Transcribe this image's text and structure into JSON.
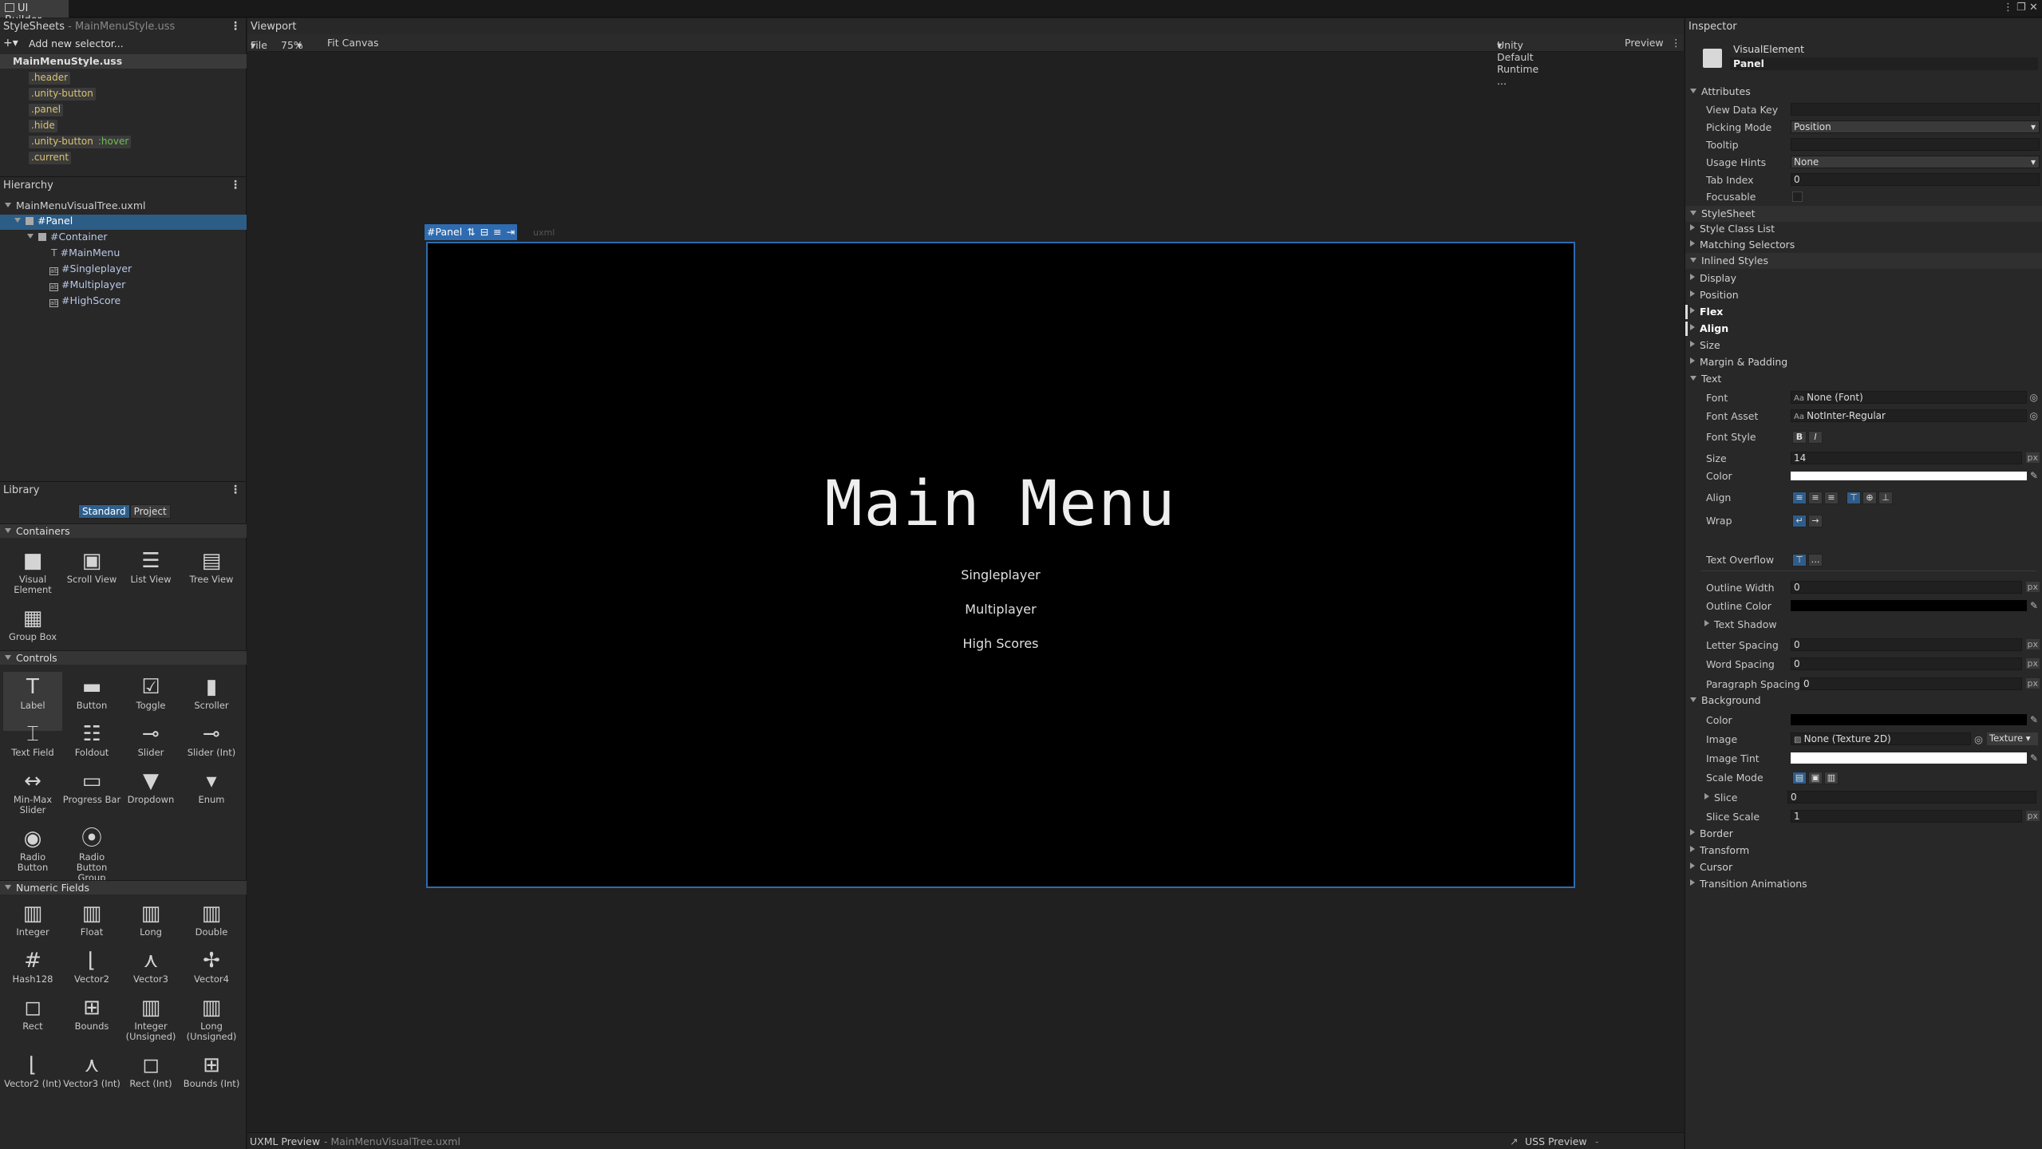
{
  "window": {
    "title": "UI Builder"
  },
  "stylesheets": {
    "header": "StyleSheets",
    "header_file": "- MainMenuStyle.uss",
    "add_placeholder": "Add new selector...",
    "file": "MainMenuStyle.uss",
    "selectors": [
      ".header",
      ".unity-button",
      ".panel",
      ".hide",
      ".unity-button",
      ".current"
    ],
    "hover_pseudo": ":hover"
  },
  "hierarchy": {
    "header": "Hierarchy",
    "file": "MainMenuVisualTree.uxml",
    "items": [
      "#Panel",
      "#Container",
      "#MainMenu",
      "#Singleplayer",
      "#Multiplayer",
      "#HighScore"
    ]
  },
  "library": {
    "header": "Library",
    "tabs": [
      "Standard",
      "Project"
    ],
    "sections": [
      "Containers",
      "Controls",
      "Numeric Fields"
    ],
    "containers": [
      "Visual Element",
      "Scroll View",
      "List View",
      "Tree View",
      "Group Box"
    ],
    "controls": [
      "Label",
      "Button",
      "Toggle",
      "Scroller",
      "Text Field",
      "Foldout",
      "Slider",
      "Slider (Int)",
      "Min-Max Slider",
      "Progress Bar",
      "Dropdown",
      "Enum",
      "Radio Button",
      "Radio Button Group"
    ],
    "numeric": [
      "Integer",
      "Float",
      "Long",
      "Double",
      "Hash128",
      "Vector2",
      "Vector3",
      "Vector4",
      "Rect",
      "Bounds",
      "Integer (Unsigned)",
      "Long (Unsigned)",
      "Vector2 (Int)",
      "Vector3 (Int)",
      "Rect (Int)",
      "Bounds (Int)"
    ]
  },
  "viewport": {
    "header": "Viewport",
    "file_menu": "File",
    "zoom": "75%",
    "fit": "Fit Canvas",
    "theme": "Unity Default Runtime ...",
    "preview": "Preview",
    "panel_badge": "#Panel",
    "badge_suffix": "uxml",
    "canvas": {
      "title": "Main Menu",
      "buttons": [
        "Singleplayer",
        "Multiplayer",
        "High Scores"
      ]
    }
  },
  "bottom": {
    "uxml_label": "UXML Preview",
    "uxml_file": "- MainMenuVisualTree.uxml",
    "uss_label": "USS Preview",
    "uss_file": "- MainMenuStyle.uss"
  },
  "inspector": {
    "header": "Inspector",
    "type": "VisualElement",
    "name": "Panel",
    "attributes_header": "Attributes",
    "attributes": [
      {
        "label": "View Data Key",
        "value": ""
      },
      {
        "label": "Picking Mode",
        "value": "Position"
      },
      {
        "label": "Tooltip",
        "value": ""
      },
      {
        "label": "Usage Hints",
        "value": "None"
      },
      {
        "label": "Tab Index",
        "value": "0"
      },
      {
        "label": "Focusable",
        "value": ""
      }
    ],
    "stylesheet_header": "StyleSheet",
    "stylesheet_items": [
      "Style Class List",
      "Matching Selectors"
    ],
    "inlined_header": "Inlined Styles",
    "inlined_items": [
      "Display",
      "Position",
      "Flex",
      "Align",
      "Size",
      "Margin & Padding"
    ],
    "text_header": "Text",
    "text": {
      "font_label": "Font",
      "font_value": "None (Font)",
      "font_asset_label": "Font Asset",
      "font_asset_value": "NotInter-Regular",
      "font_style_label": "Font Style",
      "size_label": "Size",
      "size_value": "14",
      "color_label": "Color",
      "align_label": "Align",
      "wrap_label": "Wrap",
      "overflow_label": "Text Overflow",
      "outline_width_label": "Outline Width",
      "outline_width_value": "0",
      "outline_color_label": "Outline Color",
      "shadow_label": "Text Shadow",
      "letter_label": "Letter Spacing",
      "letter_value": "0",
      "word_label": "Word Spacing",
      "word_value": "0",
      "para_label": "Paragraph Spacing",
      "para_value": "0"
    },
    "background_header": "Background",
    "background": {
      "color_label": "Color",
      "image_label": "Image",
      "image_value": "None (Texture 2D)",
      "image_type": "Texture",
      "tint_label": "Image Tint",
      "scale_label": "Scale Mode",
      "slice_label": "Slice",
      "slice_value": "0",
      "slice_scale_label": "Slice Scale",
      "slice_scale_value": "1"
    },
    "tail_items": [
      "Border",
      "Transform",
      "Cursor",
      "Transition Animations"
    ],
    "px": "px"
  }
}
